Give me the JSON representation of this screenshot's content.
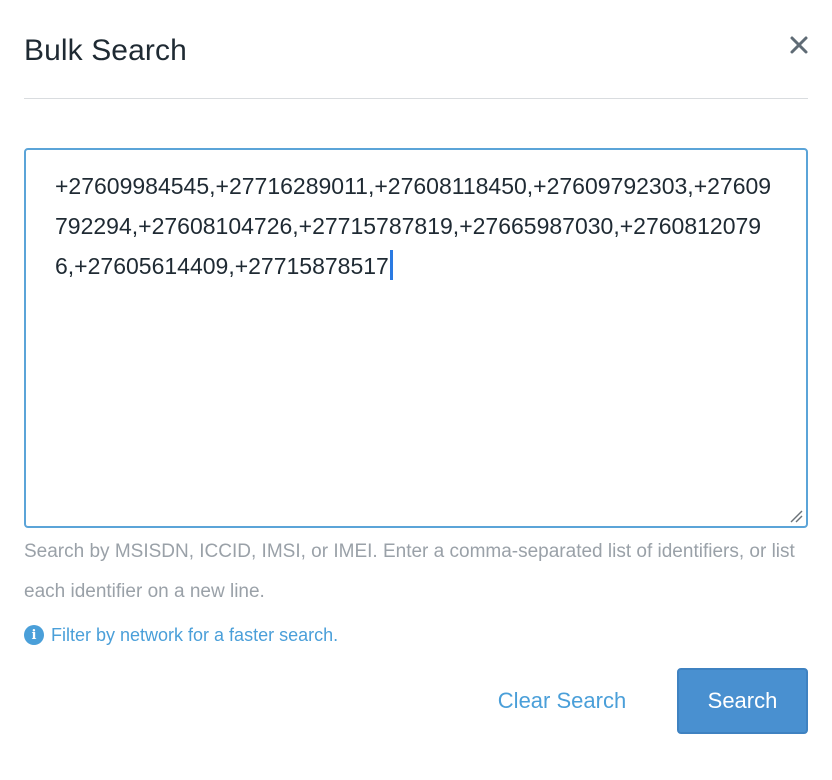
{
  "modal": {
    "title": "Bulk Search",
    "close_icon": "close-icon"
  },
  "search": {
    "value": "+27609984545,+27716289011,+27608118450,+27609792303,+27609792294,+27608104726,+27715787819,+27665987030,+27608120796,+27605614409,+27715878517",
    "help_text": "Search by MSISDN, ICCID, IMSI, or IMEI. Enter a comma-separated list of identifiers, or list each identifier on a new line."
  },
  "filter_hint": {
    "icon": "info-icon",
    "icon_glyph": "i",
    "label": "Filter by network for a faster search."
  },
  "actions": {
    "clear_label": "Clear Search",
    "search_label": "Search"
  },
  "colors": {
    "accent": "#4a9fd9",
    "primary_button": "#4990d0",
    "focus_border": "#5ba4d8",
    "muted_text": "#9aa1a8"
  }
}
